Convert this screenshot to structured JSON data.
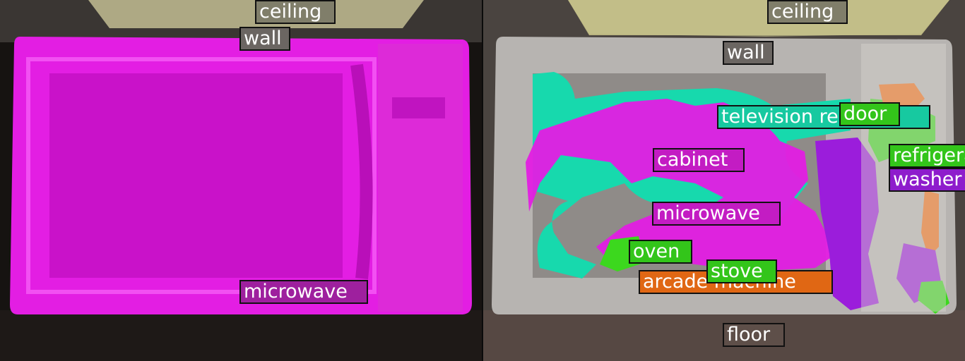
{
  "colors": {
    "microwave": "#e31ee3",
    "television": "#17d9ad",
    "door": "#3cd81e",
    "arcade_machine": "#f07018",
    "washer": "#9b1ddb",
    "refrigerator": "#3cd81e",
    "ceiling": "#c8c48e",
    "wall": "#7a7570",
    "floor": "#5a4b45"
  },
  "left_panel": {
    "labels": [
      {
        "text": "ceiling",
        "color": "#807e6a"
      },
      {
        "text": "wall",
        "color": "#6b6662"
      },
      {
        "text": "microwave",
        "color": "#9e209e"
      }
    ]
  },
  "right_panel": {
    "labels": [
      {
        "text": "ceiling",
        "color": "#807e6a"
      },
      {
        "text": "wall",
        "color": "#6b6662"
      },
      {
        "text": "television receiver",
        "color": "#17c9a0"
      },
      {
        "text": "door",
        "color": "#33c51a"
      },
      {
        "text": "cabinet",
        "color": "#c31cc3"
      },
      {
        "text": "refrigerator",
        "color": "#33c51a"
      },
      {
        "text": "washer",
        "color": "#8e1ccc"
      },
      {
        "text": "microwave",
        "color": "#c31cc3"
      },
      {
        "text": "oven",
        "color": "#33c51a"
      },
      {
        "text": "stove",
        "color": "#33c51a"
      },
      {
        "text": "arcade machine",
        "color": "#e06714"
      },
      {
        "text": "floor",
        "color": "#5e4f49"
      }
    ]
  }
}
